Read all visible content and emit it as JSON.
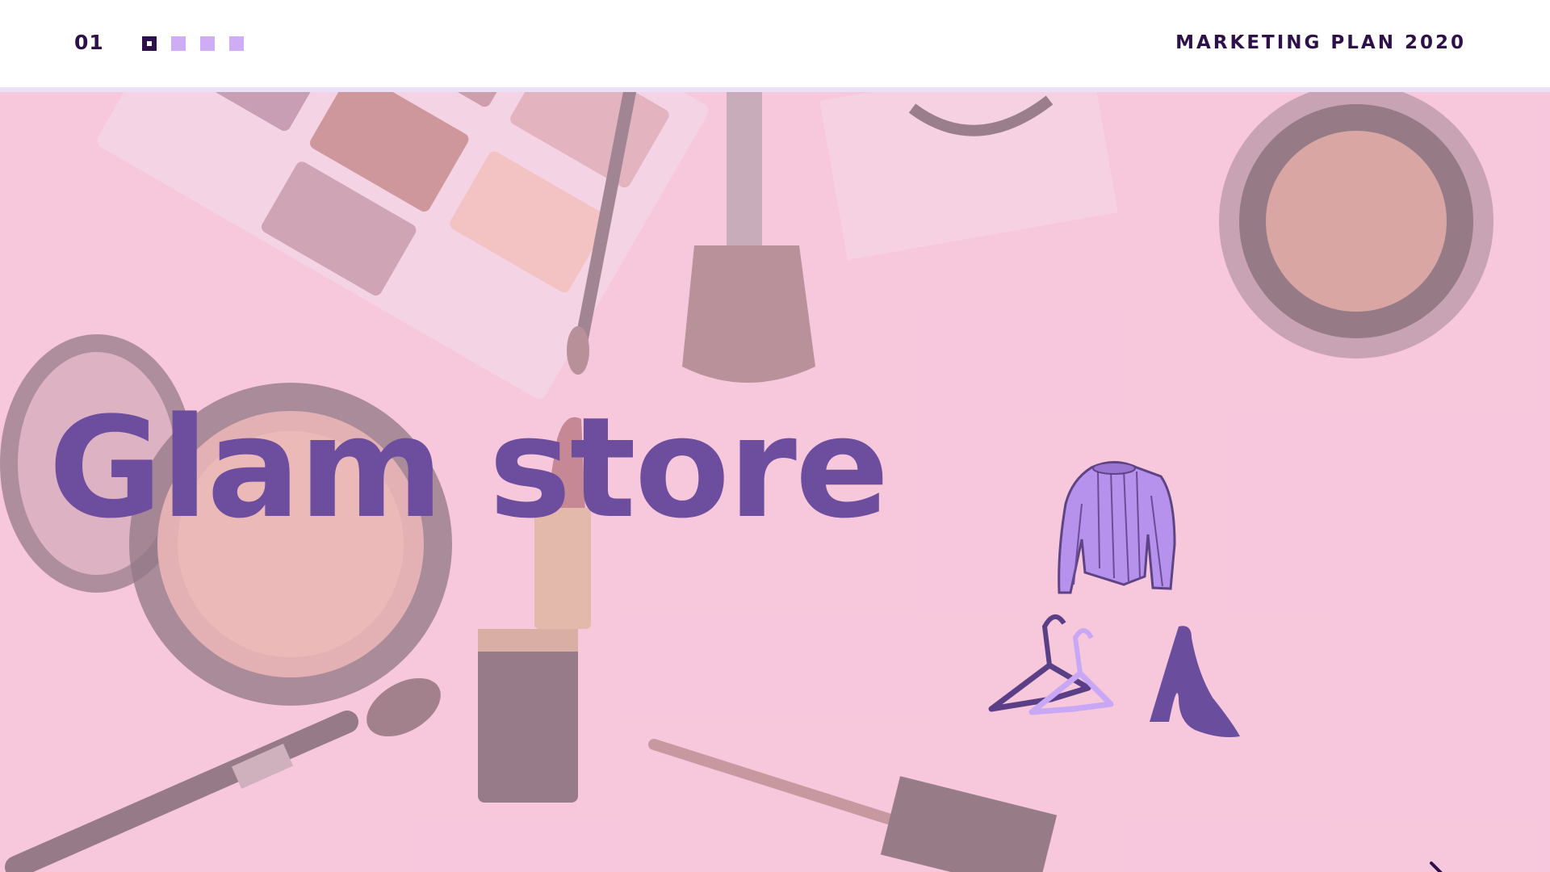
{
  "header": {
    "page_number": "01",
    "title": "MARKETING PLAN 2020",
    "pagination_dots": [
      {
        "state": "active"
      },
      {
        "state": "inactive"
      },
      {
        "state": "inactive"
      },
      {
        "state": "inactive"
      }
    ]
  },
  "hero": {
    "title": "Glam store",
    "illustration_icons": [
      "sweater-icon",
      "hanger-icon",
      "high-heel-icon"
    ]
  },
  "navigation": {
    "next_icon": "chevron-right-icon"
  },
  "colors": {
    "primary_dark": "#2d1148",
    "title_purple": "#6c4d9e",
    "accent_lilac": "#cfadf6",
    "background_pink": "#f6c7dc",
    "header_divider": "#ece0f6"
  }
}
